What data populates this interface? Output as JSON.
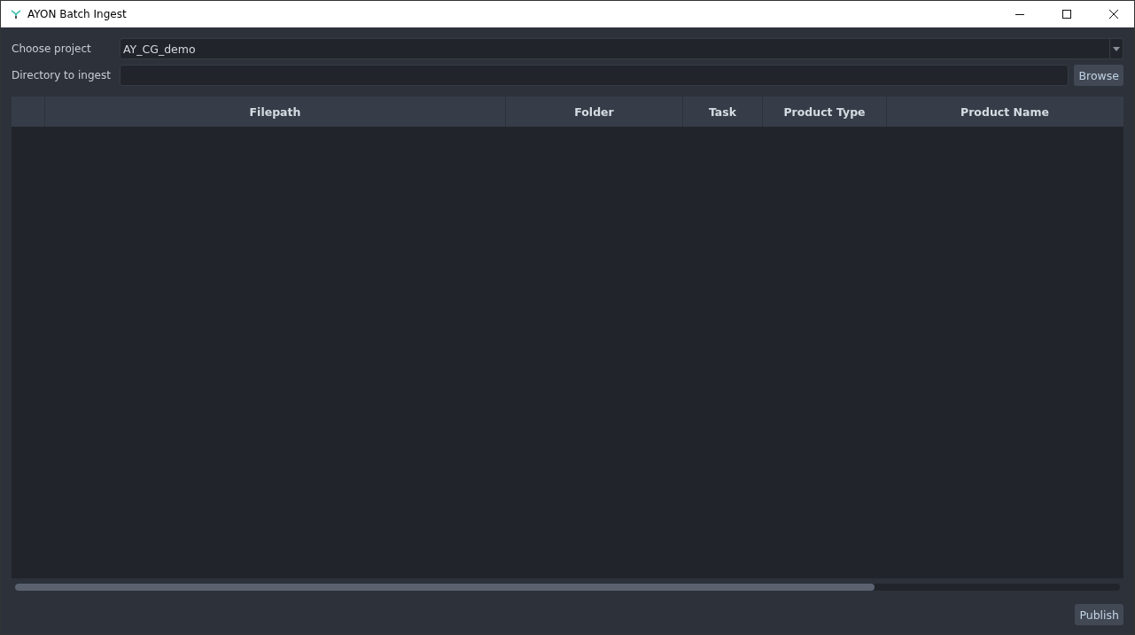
{
  "window": {
    "title": "AYON Batch Ingest"
  },
  "project": {
    "label": "Choose project",
    "value": "AY_CG_demo"
  },
  "directory": {
    "label": "Directory to ingest",
    "button": "Browse"
  },
  "table": {
    "columns": [
      {
        "kind": "selector"
      },
      {
        "label": "Filepath",
        "kind": "text"
      },
      {
        "label": "Folder",
        "kind": "text"
      },
      {
        "label": "Task",
        "kind": "text"
      },
      {
        "label": "Product Type",
        "kind": "text"
      },
      {
        "label": "Product Name",
        "kind": "text"
      }
    ]
  },
  "buttons": [
    "Publish"
  ]
}
